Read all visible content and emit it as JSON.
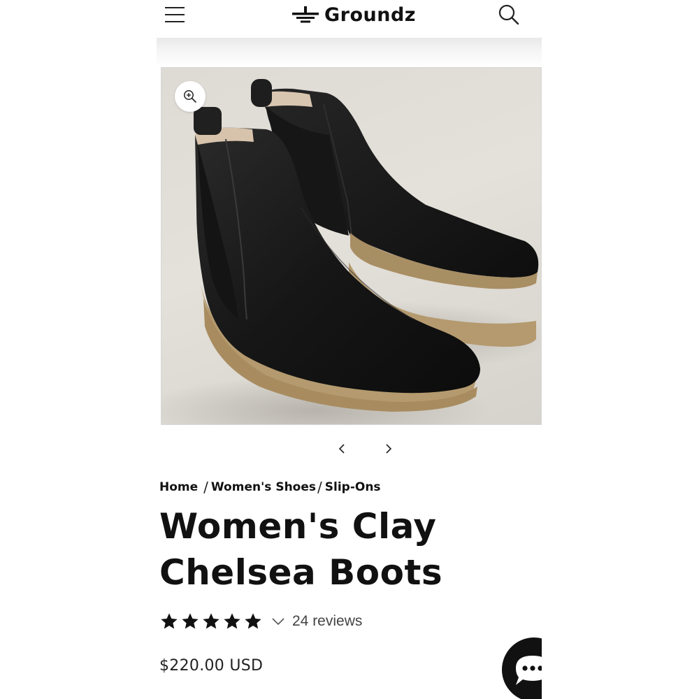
{
  "header": {
    "logo_text": "Groundz"
  },
  "breadcrumb": {
    "items": [
      "Home",
      "Women's Shoes",
      "Slip-Ons"
    ],
    "separator": "/"
  },
  "product": {
    "title": "Women's Clay Chelsea Boots",
    "rating": 5,
    "rating_max": 5,
    "reviews_label": "24 reviews",
    "price": "$220.00 USD"
  },
  "icons": {
    "menu": "hamburger-menu-icon",
    "search": "search-icon",
    "zoom": "zoom-in-icon",
    "prev": "chevron-left-icon",
    "next": "chevron-right-icon",
    "star": "star-icon",
    "dropdown": "chevron-down-icon",
    "chat": "chat-bubble-icon"
  },
  "colors": {
    "text": "#111111",
    "background": "#ffffff",
    "image_background": "#e0dcd6",
    "boot_leather": "#141414",
    "sole": "#b59c72"
  }
}
